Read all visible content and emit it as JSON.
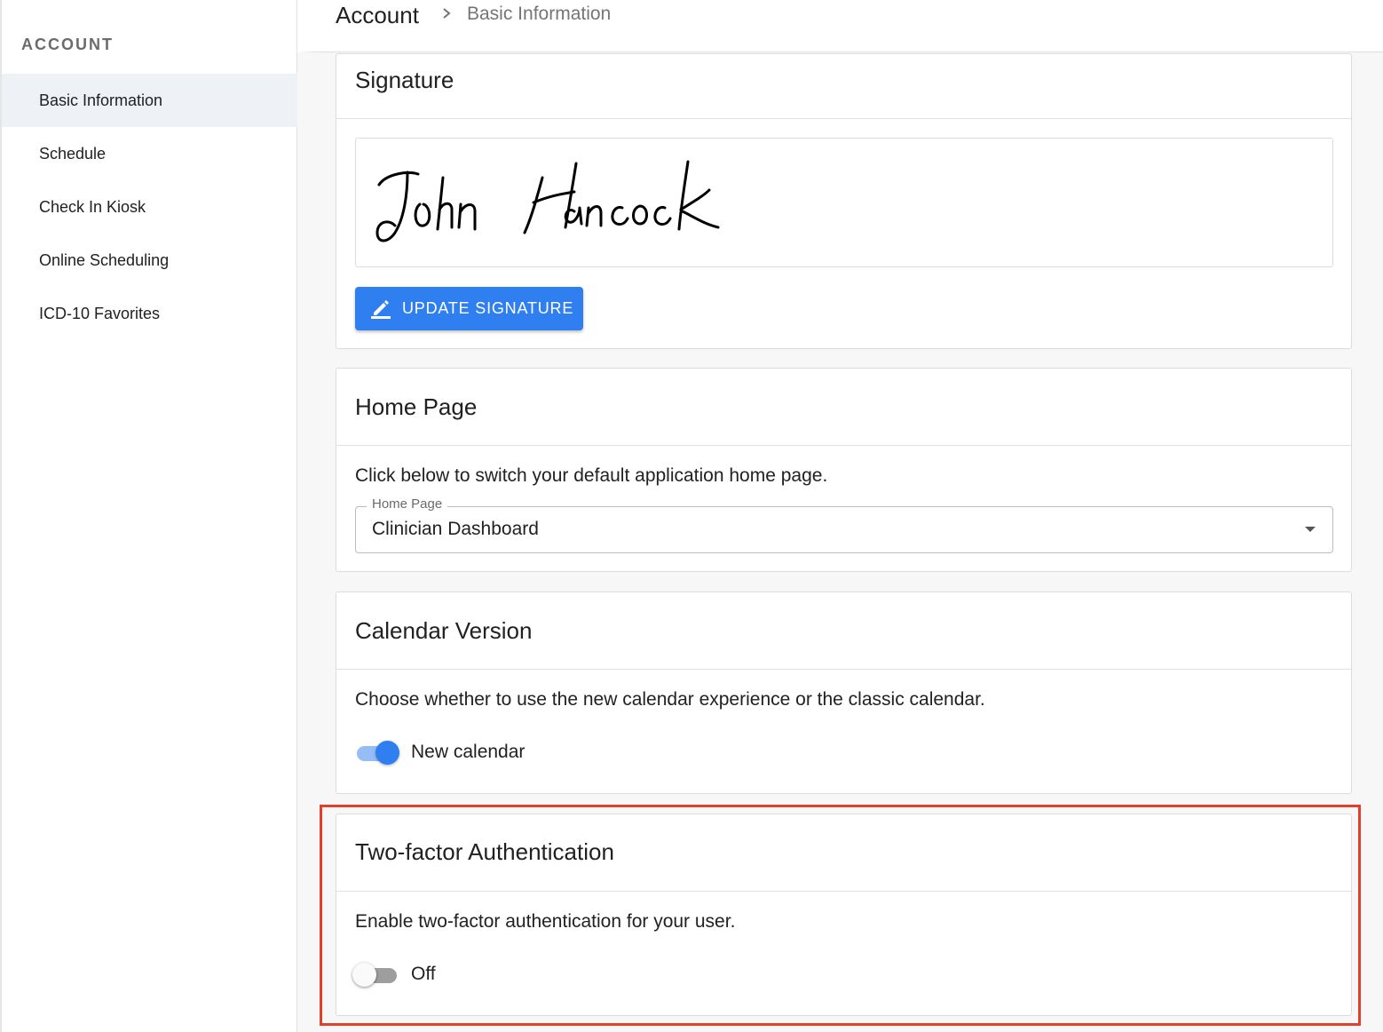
{
  "sidebar": {
    "heading": "ACCOUNT",
    "items": [
      {
        "label": "Basic Information"
      },
      {
        "label": "Schedule"
      },
      {
        "label": "Check In Kiosk"
      },
      {
        "label": "Online Scheduling"
      },
      {
        "label": "ICD-10 Favorites"
      }
    ]
  },
  "breadcrumb": {
    "root": "Account",
    "leaf": "Basic Information"
  },
  "signature": {
    "title": "Signature",
    "signed_name": "John Hancock",
    "update_button": "UPDATE SIGNATURE"
  },
  "home_page": {
    "title": "Home Page",
    "description": "Click below to switch your default application home page.",
    "select_label": "Home Page",
    "select_value": "Clinician Dashboard"
  },
  "calendar": {
    "title": "Calendar Version",
    "description": "Choose whether to use the new calendar experience or the classic calendar.",
    "toggle_label": "New calendar",
    "toggle_on": true
  },
  "two_factor": {
    "title": "Two-factor Authentication",
    "description": "Enable two-factor authentication for your user.",
    "toggle_label": "Off",
    "toggle_on": false
  },
  "colors": {
    "accent": "#2f7ff0",
    "highlight": "#e0402c",
    "active_nav_bg": "#eef2f7"
  }
}
